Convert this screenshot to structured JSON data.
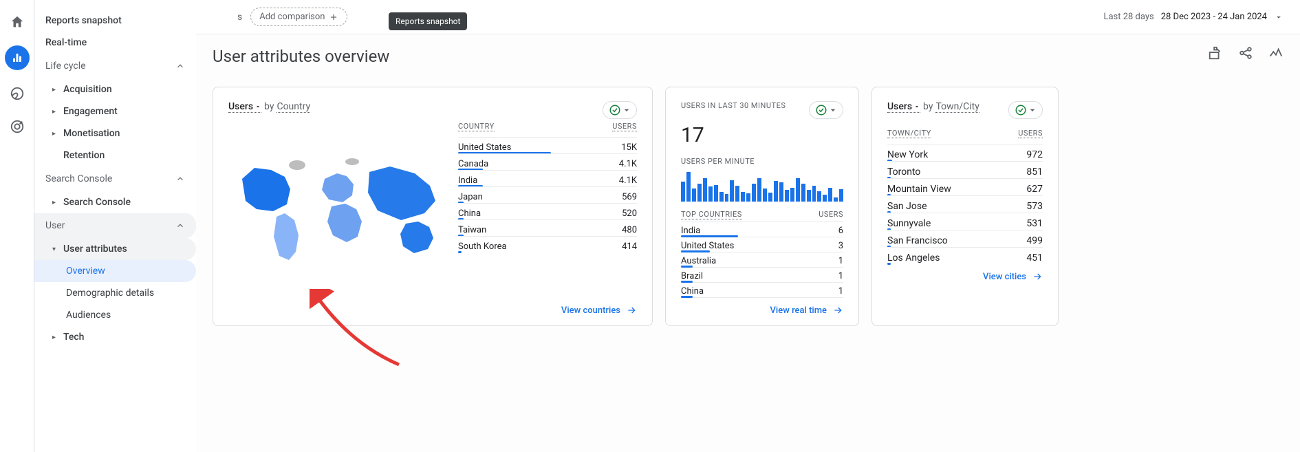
{
  "rail": {
    "icons": [
      "home-icon",
      "bar-chart-icon",
      "explore-icon",
      "target-icon"
    ]
  },
  "sidebar": {
    "reports_snapshot": "Reports snapshot",
    "realtime": "Real-time",
    "section_lifecycle": "Life cycle",
    "item_acquisition": "Acquisition",
    "item_engagement": "Engagement",
    "item_monetisation": "Monetisation",
    "item_retention": "Retention",
    "section_search_console": "Search Console",
    "item_search_console": "Search Console",
    "section_user": "User",
    "item_user_attributes": "User attributes",
    "sub_overview": "Overview",
    "sub_demographic_details": "Demographic details",
    "sub_audiences": "Audiences",
    "item_tech": "Tech"
  },
  "tooltip_text": "Reports snapshot",
  "toolbar": {
    "all_users_trailing_letter": "s",
    "add_comparison": "Add comparison",
    "date_label": "Last 28 days",
    "date_range": "28 Dec 2023 - 24 Jan 2024"
  },
  "page": {
    "title": "User attributes overview"
  },
  "card_country": {
    "metric_label": "Users",
    "by_word": "by",
    "dimension": "Country",
    "header_dim": "COUNTRY",
    "header_metric": "USERS",
    "rows": [
      {
        "name": "United States",
        "value": "15K",
        "bar_pct": 52
      },
      {
        "name": "Canada",
        "value": "4.1K",
        "bar_pct": 14
      },
      {
        "name": "India",
        "value": "4.1K",
        "bar_pct": 14
      },
      {
        "name": "Japan",
        "value": "569",
        "bar_pct": 3
      },
      {
        "name": "China",
        "value": "520",
        "bar_pct": 3
      },
      {
        "name": "Taiwan",
        "value": "480",
        "bar_pct": 3
      },
      {
        "name": "South Korea",
        "value": "414",
        "bar_pct": 2
      }
    ],
    "footer": "View countries"
  },
  "card_realtime": {
    "title": "USERS IN LAST 30 MINUTES",
    "value": "17",
    "per_minute_label": "USERS PER MINUTE",
    "spark": [
      60,
      90,
      40,
      55,
      70,
      45,
      50,
      30,
      22,
      65,
      48,
      30,
      25,
      55,
      70,
      40,
      28,
      62,
      58,
      35,
      42,
      70,
      55,
      35,
      48,
      32,
      20,
      42,
      12,
      38
    ],
    "top_countries_label": "TOP COUNTRIES",
    "users_label": "USERS",
    "rows": [
      {
        "name": "India",
        "value": "6",
        "bar_pct": 35
      },
      {
        "name": "United States",
        "value": "3",
        "bar_pct": 18
      },
      {
        "name": "Australia",
        "value": "1",
        "bar_pct": 7
      },
      {
        "name": "Brazil",
        "value": "1",
        "bar_pct": 7
      },
      {
        "name": "China",
        "value": "1",
        "bar_pct": 7
      }
    ],
    "footer": "View real time"
  },
  "card_city": {
    "metric_label": "Users",
    "by_word": "by",
    "dimension": "Town/City",
    "header_dim": "TOWN/CITY",
    "header_metric": "USERS",
    "rows": [
      {
        "name": "New York",
        "value": "972",
        "bar_pct": 3
      },
      {
        "name": "Toronto",
        "value": "851",
        "bar_pct": 2
      },
      {
        "name": "Mountain View",
        "value": "627",
        "bar_pct": 2
      },
      {
        "name": "San Jose",
        "value": "573",
        "bar_pct": 2
      },
      {
        "name": "Sunnyvale",
        "value": "531",
        "bar_pct": 2
      },
      {
        "name": "San Francisco",
        "value": "499",
        "bar_pct": 2
      },
      {
        "name": "Los Angeles",
        "value": "451",
        "bar_pct": 2
      }
    ],
    "footer": "View cities"
  },
  "chart_data": [
    {
      "type": "bar",
      "title": "Users by Country",
      "categories": [
        "United States",
        "Canada",
        "India",
        "Japan",
        "China",
        "Taiwan",
        "South Korea"
      ],
      "values": [
        15000,
        4100,
        4100,
        569,
        520,
        480,
        414
      ],
      "ylabel": "Users"
    },
    {
      "type": "bar",
      "title": "Users per minute (last 30 minutes)",
      "x": "minute bins (most recent 30)",
      "values_relative_0_100": [
        60,
        90,
        40,
        55,
        70,
        45,
        50,
        30,
        22,
        65,
        48,
        30,
        25,
        55,
        70,
        40,
        28,
        62,
        58,
        35,
        42,
        70,
        55,
        35,
        48,
        32,
        20,
        42,
        12,
        38
      ],
      "note": "Heights are relative; exact per-minute user counts not labeled on chart, total approx 17 users in window."
    },
    {
      "type": "bar",
      "title": "Top countries (real-time)",
      "categories": [
        "India",
        "United States",
        "Australia",
        "Brazil",
        "China"
      ],
      "values": [
        6,
        3,
        1,
        1,
        1
      ],
      "ylabel": "Users"
    },
    {
      "type": "bar",
      "title": "Users by Town/City",
      "categories": [
        "New York",
        "Toronto",
        "Mountain View",
        "San Jose",
        "Sunnyvale",
        "San Francisco",
        "Los Angeles"
      ],
      "values": [
        972,
        851,
        627,
        573,
        531,
        499,
        451
      ],
      "ylabel": "Users"
    }
  ]
}
